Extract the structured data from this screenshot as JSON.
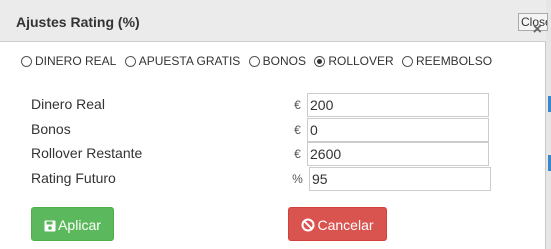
{
  "dialog": {
    "title": "Ajustes Rating (%)",
    "close_label": "Close"
  },
  "radios": [
    {
      "label": "DINERO REAL",
      "checked": false
    },
    {
      "label": "APUESTA GRATIS",
      "checked": false
    },
    {
      "label": "BONOS",
      "checked": false
    },
    {
      "label": "ROLLOVER",
      "checked": true
    },
    {
      "label": "REEMBOLSO",
      "checked": false
    }
  ],
  "fields": [
    {
      "label": "Dinero Real",
      "addon": "€",
      "value": "200"
    },
    {
      "label": "Bonos",
      "addon": "€",
      "value": "0"
    },
    {
      "label": "Rollover Restante",
      "addon": "€",
      "value": "2600"
    },
    {
      "label": "Rating Futuro",
      "addon": "%",
      "value": "95"
    }
  ],
  "buttons": {
    "apply": "Aplicar",
    "cancel": "Cancelar"
  },
  "icons": {
    "apply": "floppy-disk-icon",
    "cancel": "ban-icon",
    "close": "close-icon"
  },
  "colors": {
    "apply": "#5cb85c",
    "cancel": "#d9534f"
  }
}
